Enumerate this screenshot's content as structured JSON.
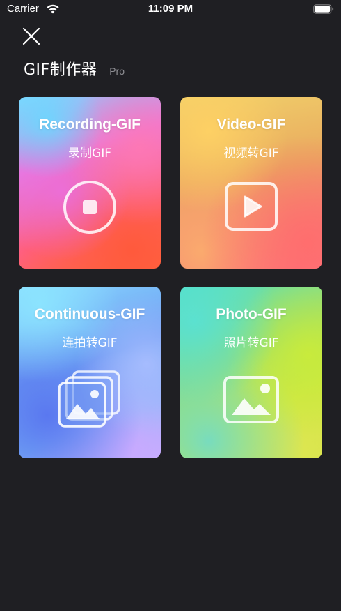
{
  "status_bar": {
    "carrier": "Carrier",
    "time": "11:09 PM",
    "wifi_icon": "wifi-icon",
    "battery_icon": "battery-icon"
  },
  "header": {
    "close_icon": "close-icon",
    "title": "GIF制作器",
    "badge": "Pro"
  },
  "cards": [
    {
      "title": "Recording-GIF",
      "subtitle": "录制GIF",
      "icon": "record-stop-icon",
      "colors": [
        "#7fd8ff",
        "#e67ae0",
        "#ff5f80",
        "#ff6a3a"
      ]
    },
    {
      "title": "Video-GIF",
      "subtitle": "视频转GIF",
      "icon": "play-icon",
      "colors": [
        "#f0cf6a",
        "#e9a95e",
        "#f37f74",
        "#ff6c80"
      ]
    },
    {
      "title": "Continuous-GIF",
      "subtitle": "连拍转GIF",
      "icon": "photo-stack-icon",
      "colors": [
        "#8cdcff",
        "#6a9cf2",
        "#7ab6f5",
        "#c9b0ff"
      ]
    },
    {
      "title": "Photo-GIF",
      "subtitle": "照片转GIF",
      "icon": "photo-icon",
      "colors": [
        "#4fe0c8",
        "#8fdc7a",
        "#c8e83a",
        "#d6e04a"
      ]
    }
  ],
  "theme": {
    "background": "#1f1f23",
    "badge_color": "#8e8e93"
  }
}
